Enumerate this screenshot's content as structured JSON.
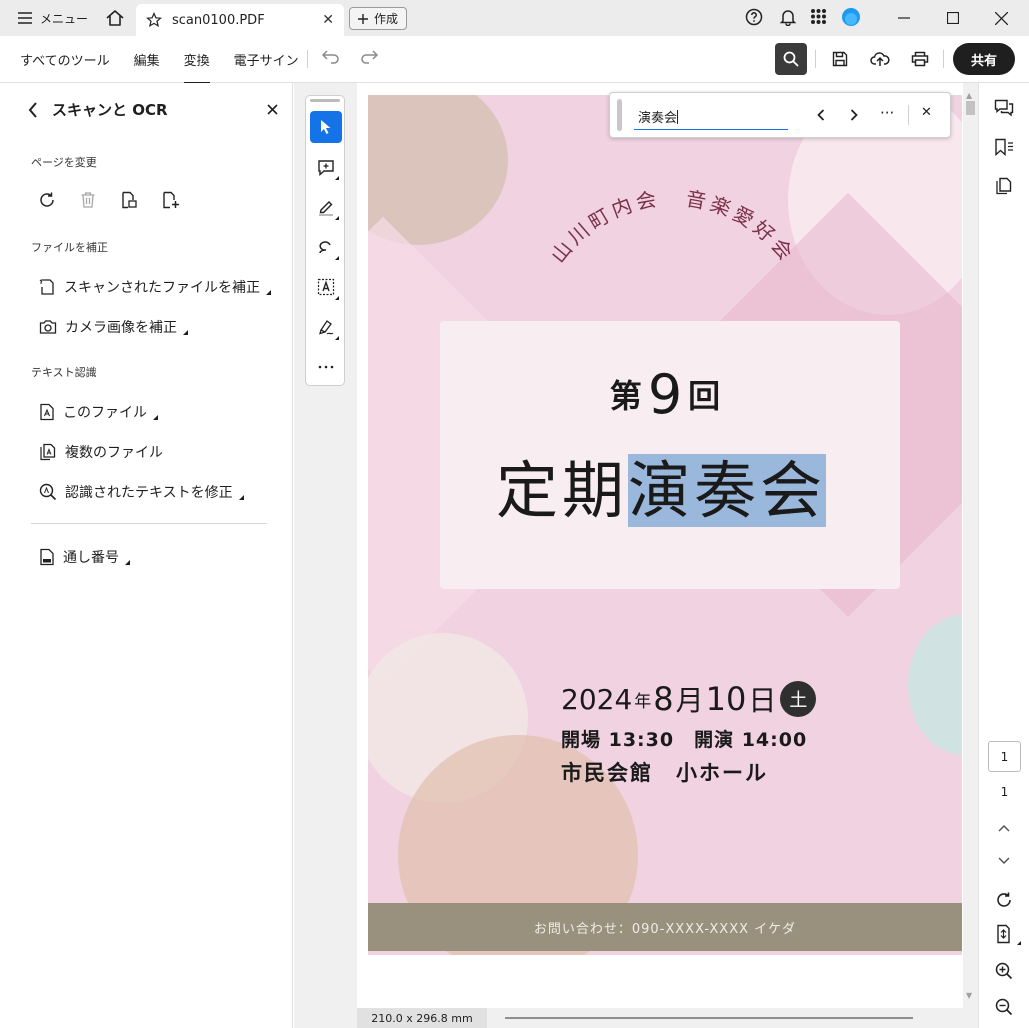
{
  "titlebar": {
    "menu_label": "メニュー",
    "tab_title": "scan0100.PDF",
    "tab_close": "✕",
    "new_label": "作成"
  },
  "toolbar": {
    "tabs": [
      "すべてのツール",
      "編集",
      "変換",
      "電子サイン"
    ],
    "active_tab": "変換",
    "share_label": "共有"
  },
  "left_panel": {
    "title": "スキャンと OCR",
    "sections": {
      "change_page": "ページを変更",
      "fix_file": "ファイルを補正",
      "text_recognition": "テキスト認識"
    },
    "items": {
      "fix_scanned": "スキャンされたファイルを補正",
      "fix_camera": "カメラ画像を補正",
      "this_file": "このファイル",
      "multiple_files": "複数のファイル",
      "fix_recognized": "認識されたテキストを修正",
      "bates": "通し番号"
    }
  },
  "find": {
    "query": "演奏会",
    "more": "···",
    "close": "✕"
  },
  "document": {
    "arc_text": "山川町内会　音楽愛好会",
    "dai": "第",
    "number": "9",
    "kai": "回",
    "title_plain": "定期",
    "title_highlight": "演奏会",
    "year": "2024",
    "year_unit": "年",
    "month": "8",
    "month_unit": "月",
    "day": "10",
    "day_unit": "日",
    "weekday": "土",
    "times": "開場 13:30　開演 14:00",
    "venue": "市民会館　小ホール",
    "contact": "お問い合わせ：090-XXXX-XXXX イケダ"
  },
  "navigation": {
    "current_page": "1",
    "total_pages": "1"
  },
  "status": {
    "page_size": "210.0 x 296.8 mm"
  },
  "colors": {
    "accent": "#1473e6",
    "highlight": "#9ab8dc",
    "page_pink": "#f1d2e1",
    "footer_band": "#9a907e"
  }
}
